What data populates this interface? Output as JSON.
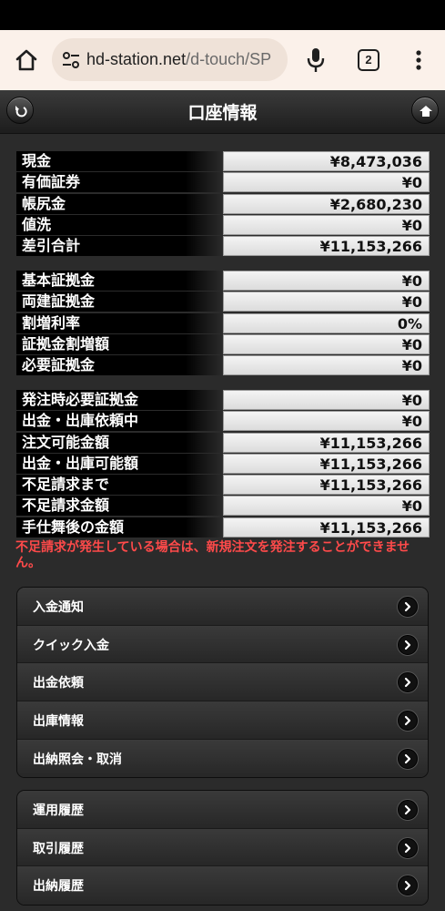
{
  "browser": {
    "url_host": "hd-station.net",
    "url_path": "/d-touch/SP",
    "tab_count": "2"
  },
  "header": {
    "title": "口座情報"
  },
  "groups": [
    [
      {
        "label": "現金",
        "value": "¥8,473,036"
      },
      {
        "label": "有価証券",
        "value": "¥0"
      },
      {
        "label": "帳尻金",
        "value": "¥2,680,230"
      },
      {
        "label": "値洗",
        "value": "¥0"
      },
      {
        "label": "差引合計",
        "value": "¥11,153,266"
      }
    ],
    [
      {
        "label": "基本証拠金",
        "value": "¥0"
      },
      {
        "label": "両建証拠金",
        "value": "¥0"
      },
      {
        "label": "割増利率",
        "value": "0%"
      },
      {
        "label": "証拠金割増額",
        "value": "¥0"
      },
      {
        "label": "必要証拠金",
        "value": "¥0"
      }
    ],
    [
      {
        "label": "発注時必要証拠金",
        "value": "¥0"
      },
      {
        "label": "出金・出庫依頼中",
        "value": "¥0"
      },
      {
        "label": "注文可能金額",
        "value": "¥11,153,266"
      },
      {
        "label": "出金・出庫可能額",
        "value": "¥11,153,266"
      },
      {
        "label": "不足請求まで",
        "value": "¥11,153,266"
      },
      {
        "label": "不足請求金額",
        "value": "¥0"
      },
      {
        "label": "手仕舞後の金額",
        "value": "¥11,153,266"
      }
    ]
  ],
  "warning": "不足請求が発生している場合は、新規注文を発注することができません。",
  "menu1": [
    "入金通知",
    "クイック入金",
    "出金依頼",
    "出庫情報",
    "出納照会・取消"
  ],
  "menu2": [
    "運用履歴",
    "取引履歴",
    "出納履歴"
  ]
}
